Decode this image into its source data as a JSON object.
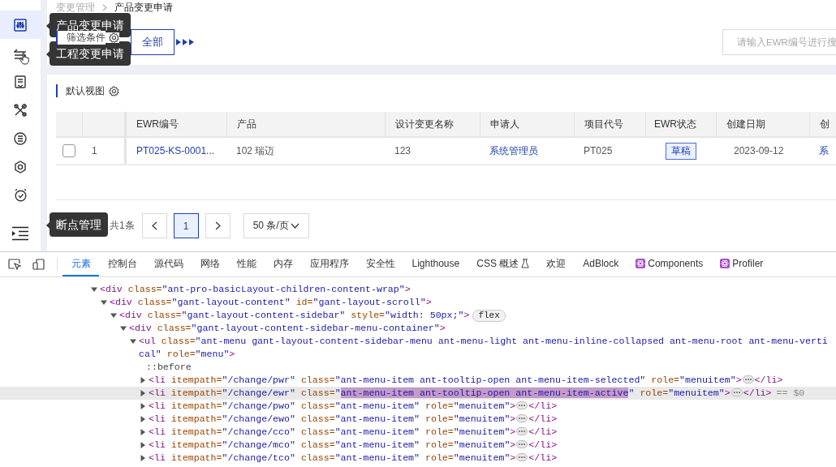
{
  "sidebar": {
    "items": [
      {
        "selected": true,
        "hovered": false,
        "tooltip": "产品变更申请"
      },
      {
        "selected": false,
        "hovered": true,
        "tooltip": "工程变更申请"
      },
      {
        "selected": false,
        "hovered": false
      },
      {
        "selected": false,
        "hovered": false
      },
      {
        "selected": false,
        "hovered": false
      },
      {
        "selected": false,
        "hovered": false
      },
      {
        "selected": false,
        "hovered": false
      }
    ],
    "collapse_button": {
      "tooltip": "断点管理"
    }
  },
  "breadcrumb": [
    "变更管理",
    "产品变更申请"
  ],
  "filter": {
    "label": "筛选条件",
    "options": [
      {
        "label": "全部",
        "selected": true
      }
    ],
    "search": {
      "placeholder": "请输入EWR编号进行搜"
    }
  },
  "view": {
    "title": "默认视图"
  },
  "table": {
    "columns": [
      "EWR编号",
      "产品",
      "设计变更名称",
      "申请人",
      "项目代号",
      "EWR状态",
      "创建日期",
      "创"
    ],
    "rows": [
      {
        "checked": false,
        "index": "1",
        "cells": [
          {
            "kind": "link",
            "text": "PT025-KS-0001..."
          },
          {
            "kind": "text",
            "text": "102 瑞迈"
          },
          {
            "kind": "text",
            "text": "123"
          },
          {
            "kind": "link",
            "text": "系统管理员"
          },
          {
            "kind": "text",
            "text": "PT025"
          },
          {
            "kind": "tag",
            "text": "草稿"
          },
          {
            "kind": "date",
            "text": "2023-09-12"
          },
          {
            "kind": "link",
            "text": "系"
          }
        ]
      }
    ]
  },
  "pagination": {
    "total": "共1条",
    "pages": [
      {
        "label": "1",
        "selected": true
      }
    ],
    "page_size": "50 条/页"
  },
  "devtools": {
    "tabs": [
      {
        "label": "元素",
        "selected": true,
        "kind": "plain"
      },
      {
        "label": "控制台",
        "selected": false,
        "kind": "plain"
      },
      {
        "label": "源代码",
        "selected": false,
        "kind": "plain"
      },
      {
        "label": "网络",
        "selected": false,
        "kind": "plain"
      },
      {
        "label": "性能",
        "selected": false,
        "kind": "plain"
      },
      {
        "label": "内存",
        "selected": false,
        "kind": "plain"
      },
      {
        "label": "应用程序",
        "selected": false,
        "kind": "plain"
      },
      {
        "label": "安全性",
        "selected": false,
        "kind": "plain"
      },
      {
        "label": "Lighthouse",
        "selected": false,
        "kind": "plain"
      },
      {
        "label": "CSS 概述",
        "selected": false,
        "kind": "experimental"
      },
      {
        "label": "欢迎",
        "selected": false,
        "kind": "plain"
      },
      {
        "label": "AdBlock",
        "selected": false,
        "kind": "plain"
      },
      {
        "label": "Components",
        "selected": false,
        "kind": "extension"
      },
      {
        "label": "Profiler",
        "selected": false,
        "kind": "extension"
      }
    ],
    "dom": [
      {
        "open": "<div class=\"ant-pro-basicLayout-children-content-wrap\">",
        "expanded": true,
        "children": [
          {
            "open": "<div class=\"gant-layout-content\" id=\"gant-layout-scroll\">",
            "expanded": true,
            "children": [
              {
                "open": "<div class=\"gant-layout-content-sidebar\" style=\"width: 50px;\">",
                "badge": "flex",
                "expanded": true,
                "children": [
                  {
                    "open": "<div class=\"gant-layout-content-sidebar-menu-container\">",
                    "expanded": true,
                    "children": [
                      {
                        "open": "<ul class=\"ant-menu gant-layout-content-sidebar-menu ant-menu-light ant-menu-inline-collapsed ant-menu-root ant-menu-vertical\" role=\"menu\">",
                        "expanded": true,
                        "children": [
                          {
                            "pseudo": "::before"
                          },
                          {
                            "open": "<li itempath=\"/change/pwr\" class=\"ant-menu-item ant-tooltip-open ant-menu-item-selected\" role=\"menuitem\">",
                            "expanded": false,
                            "close": "</li>",
                            "selected": false
                          },
                          {
                            "open": "<li itempath=\"/change/ewr\" class=\"",
                            "marked": "ant-menu-item ant-tooltip-open ant-menu-item-active",
                            "open_end": "\" role=\"menuitem\">",
                            "expanded": false,
                            "close": "</li>",
                            "selected": true,
                            "note": "== $0"
                          },
                          {
                            "open": "<li itempath=\"/change/pwo\" class=\"ant-menu-item\" role=\"menuitem\">",
                            "expanded": false,
                            "close": "</li>",
                            "selected": false
                          },
                          {
                            "open": "<li itempath=\"/change/ewo\" class=\"ant-menu-item\" role=\"menuitem\">",
                            "expanded": false,
                            "close": "</li>",
                            "selected": false
                          },
                          {
                            "open": "<li itempath=\"/change/cco\" class=\"ant-menu-item\" role=\"menuitem\">",
                            "expanded": false,
                            "close": "</li>",
                            "selected": false
                          },
                          {
                            "open": "<li itempath=\"/change/mco\" class=\"ant-menu-item\" role=\"menuitem\">",
                            "expanded": false,
                            "close": "</li>",
                            "selected": false
                          },
                          {
                            "open": "<li itempath=\"/change/tco\" class=\"ant-menu-item\" role=\"menuitem\">",
                            "expanded": false,
                            "close": "</li>",
                            "selected": false
                          }
                        ]
                      }
                    ]
                  }
                ]
              }
            ]
          }
        ]
      }
    ]
  }
}
